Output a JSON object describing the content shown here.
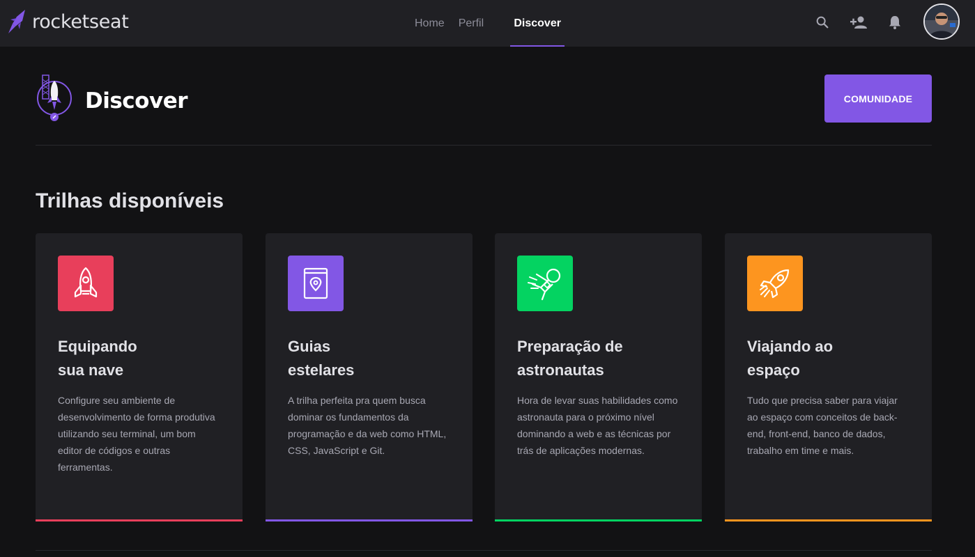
{
  "brand": {
    "name": "rocketseat"
  },
  "nav": {
    "items": [
      {
        "label": "Home"
      },
      {
        "label": "Perfil"
      },
      {
        "label": "Discover"
      }
    ]
  },
  "header_icons": [
    "search-icon",
    "add-user-icon",
    "bell-icon"
  ],
  "page": {
    "title": "Discover",
    "community_button": "COMUNIDADE"
  },
  "section": {
    "title": "Trilhas disponíveis"
  },
  "cards": [
    {
      "title_line1": "Equipando",
      "title_line2": "sua nave",
      "description": "Configure seu ambiente de desenvolvimento de forma produtiva utilizando seu terminal, um bom editor de códigos e outras ferramentas.",
      "color": "#e83f5b",
      "icon": "rocket-icon"
    },
    {
      "title_line1": "Guias",
      "title_line2": "estelares",
      "description": "A trilha perfeita pra quem busca dominar os fundamentos da programação e da web como HTML, CSS, JavaScript e Git.",
      "color": "#8257e5",
      "icon": "map-book-icon"
    },
    {
      "title_line1": "Preparação de",
      "title_line2": "astronautas",
      "description": "Hora de levar suas habilidades como astronauta para o próximo nível dominando a web e as técnicas por trás de aplicações modernas.",
      "color": "#04d361",
      "icon": "astronaut-icon"
    },
    {
      "title_line1": "Viajando ao",
      "title_line2": "espaço",
      "description": "Tudo que precisa saber para viajar ao espaço com conceitos de back-end, front-end, banco de dados, trabalho em time e mais.",
      "color": "#fd951f",
      "icon": "launching-rocket-icon"
    }
  ],
  "colors": {
    "background": "#121214",
    "topbar": "#202024",
    "card": "#202024",
    "accent": "#8257e5"
  }
}
